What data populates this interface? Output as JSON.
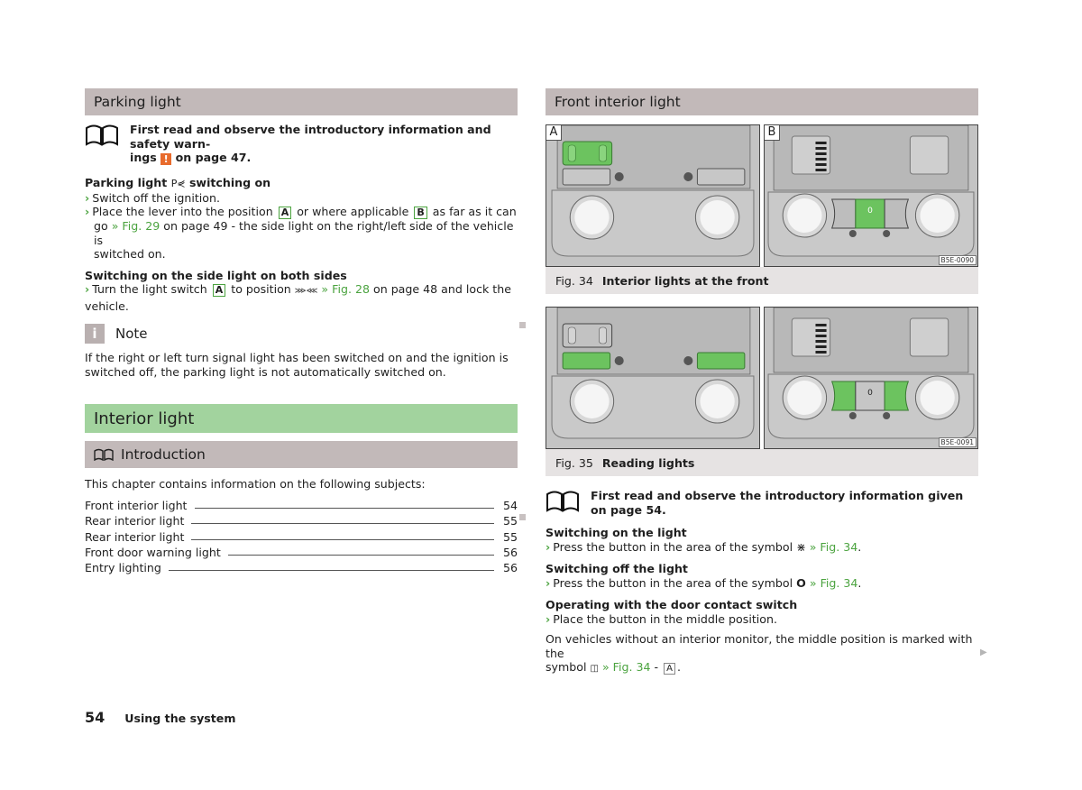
{
  "left": {
    "parking_light": {
      "title": "Parking light",
      "read_first": "First read and observe the introductory information and safety warn-",
      "read_first_2a": "ings",
      "read_first_warn": "!",
      "read_first_2b": "on page 47.",
      "switch_on_heading_a": "Parking light",
      "switch_on_symbol": "P⋞",
      "switch_on_heading_b": "switching on",
      "steps": {
        "s1": "Switch off the ignition.",
        "s2a": "Place the lever into the position",
        "s2_box1": "A",
        "s2b": "or where applicable",
        "s2_box2": "B",
        "s2c": "as far as it can",
        "s2d": "go",
        "s2_link": "» Fig. 29",
        "s2e": "on page 49 - the side light on the right/left side of the vehicle is",
        "s2f": "switched on."
      },
      "both_sides_heading": "Switching on the side light on both sides",
      "both_sides": {
        "a": "Turn the light switch",
        "box": "A",
        "b": "to position",
        "symbol": "⋙⋘",
        "link": "» Fig. 28",
        "c": "on page 48 and lock the vehicle."
      },
      "note_icon": "i",
      "note_title": "Note",
      "note_text_1": "If the right or left turn signal light has been switched on and the ignition is",
      "note_text_2": "switched off, the parking light is not automatically switched on."
    },
    "interior_light": {
      "title": "Interior light",
      "intro_title": "Introduction",
      "intro_text": "This chapter contains information on the following subjects:",
      "toc": [
        {
          "label": "Front interior light",
          "page": "54"
        },
        {
          "label": "Rear interior light",
          "page": "55"
        },
        {
          "label": "Rear interior light",
          "page": "55"
        },
        {
          "label": "Front door warning light",
          "page": "56"
        },
        {
          "label": "Entry lighting",
          "page": "56"
        }
      ]
    }
  },
  "right": {
    "title": "Front interior light",
    "fig34": {
      "panel_a": "A",
      "panel_b": "B",
      "code": "B5E-0090",
      "num": "Fig. 34",
      "caption": "Interior lights at the front",
      "switch_zero": "0"
    },
    "fig35": {
      "code": "B5E-0091",
      "num": "Fig. 35",
      "caption": "Reading lights",
      "switch_zero": "0"
    },
    "read_first": "First read and observe the introductory information given on page 54.",
    "on_heading": "Switching on the light",
    "on_a": "Press the button in the area of the symbol",
    "on_symbol": "⋇",
    "on_link": "» Fig. 34",
    "off_heading": "Switching off the light",
    "off_a": "Press the button in the area of the symbol",
    "off_symbol": "O",
    "off_link": "» Fig. 34",
    "door_heading": "Operating with the door contact switch",
    "door_step": "Place the button in the middle position.",
    "monitor_1": "On vehicles without an interior monitor, the middle position is marked with the",
    "monitor_2a": "symbol",
    "monitor_symbol": "◫",
    "monitor_link": "» Fig. 34",
    "monitor_dash": "-",
    "monitor_box": "A"
  },
  "footer": {
    "page_number": "54",
    "section": "Using the system"
  }
}
